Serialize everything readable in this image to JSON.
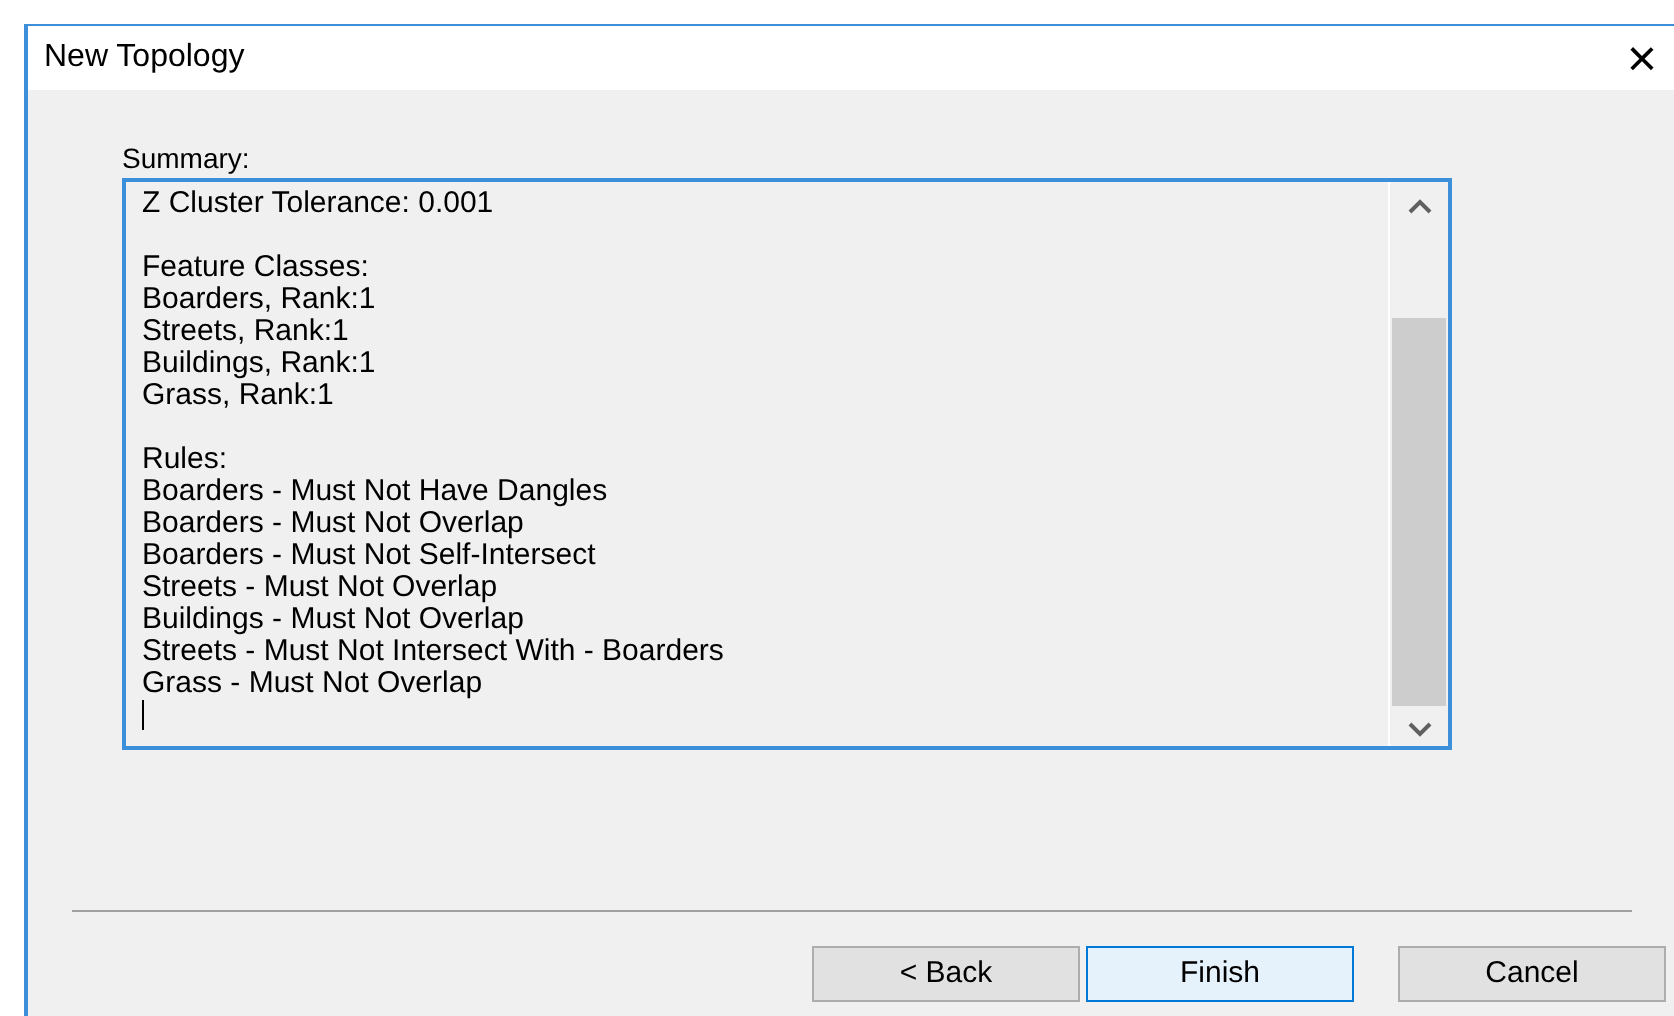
{
  "window": {
    "title": "New Topology",
    "close": "×"
  },
  "summary": {
    "label": "Summary:",
    "groups": [
      [
        "Z Cluster Tolerance: 0.001"
      ],
      [
        "Feature Classes:",
        "Boarders, Rank:1",
        "Streets, Rank:1",
        "Buildings, Rank:1",
        "Grass, Rank:1"
      ],
      [
        "Rules:",
        "Boarders - Must Not Have Dangles",
        "Boarders - Must Not Overlap",
        "Boarders - Must Not Self-Intersect",
        "Streets - Must Not Overlap",
        "Buildings - Must Not Overlap",
        "Streets - Must Not Intersect With - Boarders",
        "Grass - Must Not Overlap"
      ]
    ]
  },
  "buttons": [
    {
      "label": "< Back",
      "default": false
    },
    {
      "label": "Finish",
      "default": true
    },
    {
      "label": "Cancel",
      "default": false
    }
  ]
}
